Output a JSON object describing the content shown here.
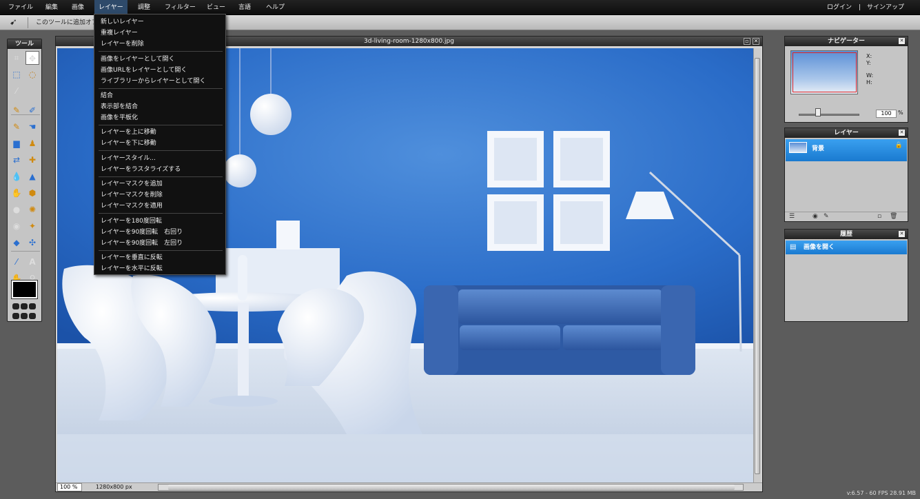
{
  "menubar": {
    "items": [
      "ファイル",
      "編集",
      "画像",
      "レイヤー",
      "調整",
      "フィルター",
      "ビュー",
      "言語",
      "ヘルプ"
    ],
    "login": "ログイン",
    "divider": "|",
    "signup": "サインアップ"
  },
  "toolbar": {
    "hint": "このツールに追加オプションはありません"
  },
  "layer_menu": {
    "items": [
      "新しいレイヤー",
      "重複レイヤー",
      "レイヤーを削除",
      "画像をレイヤーとして開く",
      "画像URLをレイヤーとして開く",
      "ライブラリーからレイヤーとして開く",
      "結合",
      "表示部を結合",
      "画像を平板化",
      "レイヤーを上に移動",
      "レイヤーを下に移動",
      "レイヤースタイル...",
      "レイヤーをラスタライズする",
      "レイヤーマスクを追加",
      "レイヤーマスクを削除",
      "レイヤーマスクを適用",
      "レイヤーを180度回転",
      "レイヤーを90度回転　右回り",
      "レイヤーを90度回転　左回り",
      "レイヤーを垂直に反転",
      "レイヤーを水平に反転"
    ]
  },
  "tools": {
    "title": "ツール",
    "icons": [
      "crop-icon",
      "move-icon",
      "marquee-icon",
      "lasso-icon",
      "wand-icon",
      "pencil-icon",
      "brush-icon",
      "clone-icon",
      "smudge-icon",
      "gradient-icon",
      "stamp-icon",
      "replace-color-icon",
      "heal-icon",
      "drop-icon",
      "sharpen-icon",
      "sponge-icon",
      "dodge-icon",
      "burn-icon",
      "red-eye-icon",
      "spot-icon",
      "bloat-icon",
      "pinch-icon",
      "picker-icon",
      "type-icon",
      "hand-icon",
      "zoom-icon"
    ],
    "foreground_color": "#000000"
  },
  "canvas": {
    "title": "3d-living-room-1280x800.jpg",
    "zoom": "100",
    "zoom_unit": "%",
    "dimensions": "1280x800 px"
  },
  "navigator": {
    "title": "ナビゲーター",
    "x_label": "X:",
    "y_label": "Y:",
    "w_label": "W:",
    "h_label": "H:",
    "zoom": "100",
    "percent": "%"
  },
  "layers": {
    "title": "レイヤー",
    "items": [
      {
        "name": "背景",
        "selected": true
      }
    ]
  },
  "history": {
    "title": "履歴",
    "items": [
      {
        "name": "画像を開く",
        "selected": true
      }
    ]
  },
  "footer": {
    "fps": "v:6.57 - 60 FPS 28.91 MB"
  },
  "colors": {
    "accent": "#1a7ad0",
    "menu_bg": "#111111",
    "panel_bg": "#c5c5c5"
  }
}
